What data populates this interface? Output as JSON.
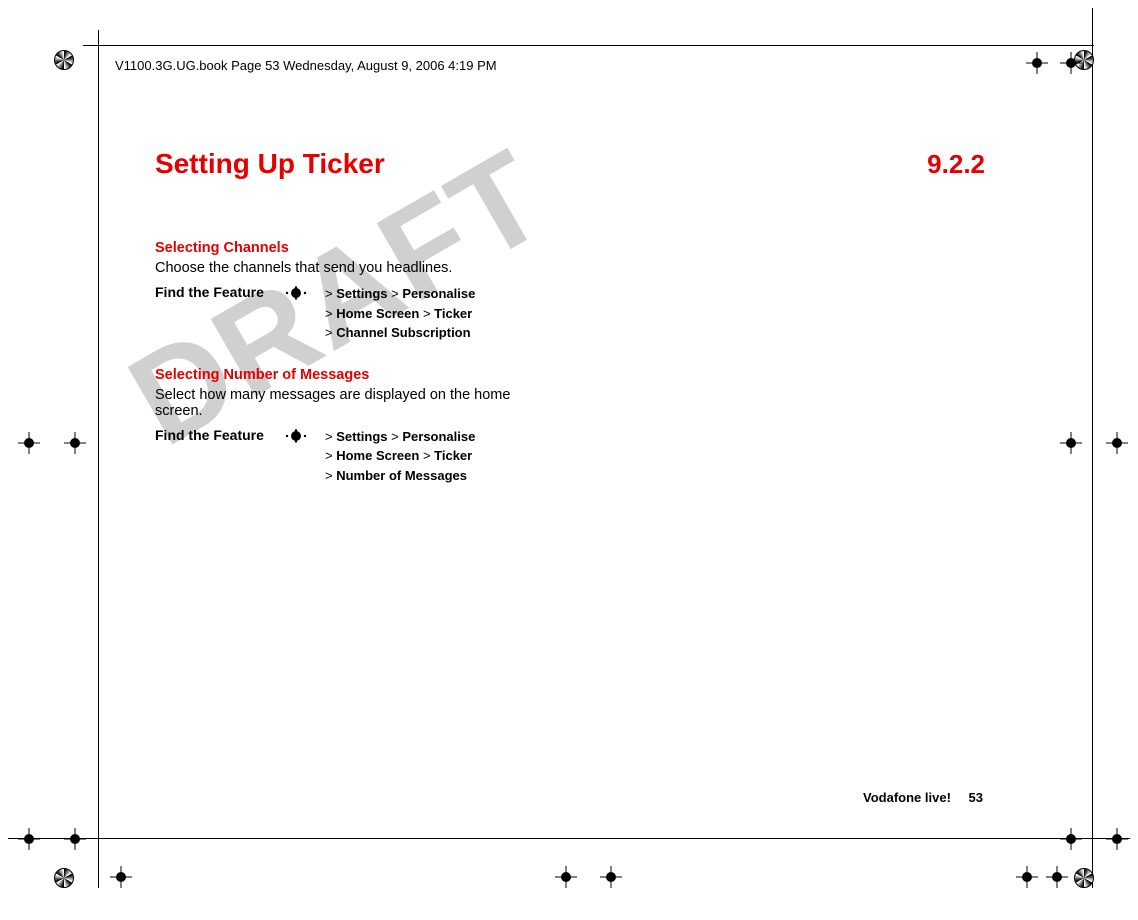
{
  "header": "V1100.3G.UG.book  Page 53  Wednesday, August 9, 2006  4:19 PM",
  "watermark": "DRAFT",
  "title": "Setting Up Ticker",
  "section_number": "9.2.2",
  "block1": {
    "heading": "Selecting Channels",
    "body": "Choose the channels that send you headlines.",
    "feature_label": "Find the Feature",
    "nav": {
      "l1a": "Settings",
      "l1b": "Personalise",
      "l2a": "Home Screen",
      "l2b": "Ticker",
      "l3": "Channel Subscription"
    }
  },
  "block2": {
    "heading": "Selecting Number of Messages",
    "body": "Select how many messages are displayed on the home screen.",
    "feature_label": "Find the Feature",
    "nav": {
      "l1a": "Settings",
      "l1b": "Personalise",
      "l2a": "Home Screen",
      "l2b": "Ticker",
      "l3": "Number of Messages"
    }
  },
  "footer": {
    "label": "Vodafone live!",
    "page": "53"
  }
}
